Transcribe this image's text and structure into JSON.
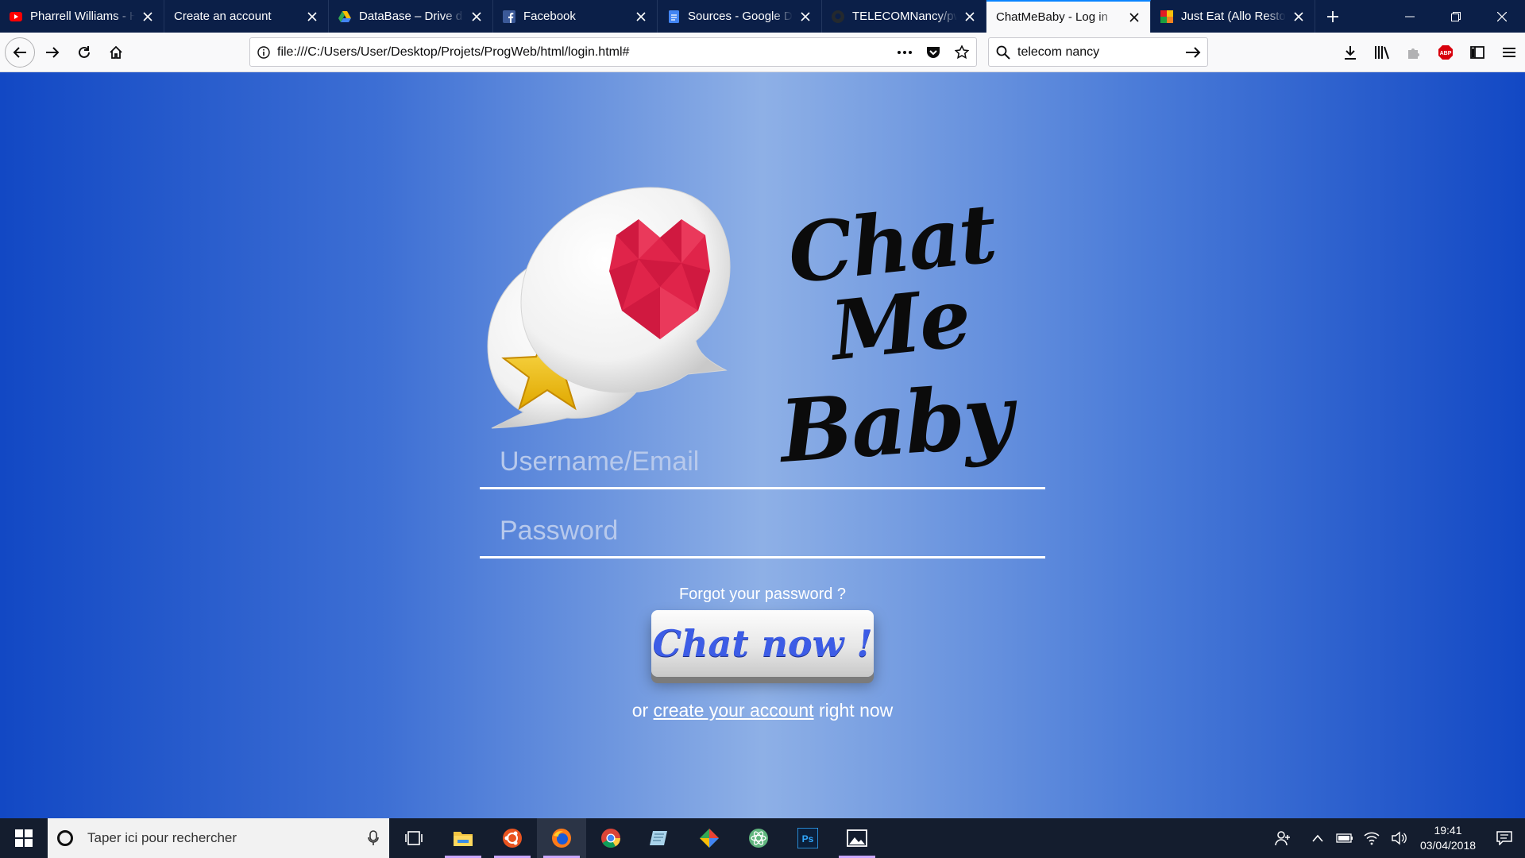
{
  "tabs": [
    {
      "title": "Pharrell Williams - H",
      "icon": "youtube-icon",
      "active": false
    },
    {
      "title": "Create an account",
      "icon": "none",
      "active": false
    },
    {
      "title": "DataBase – Drive d",
      "icon": "google-drive-icon",
      "active": false
    },
    {
      "title": "Facebook",
      "icon": "facebook-icon",
      "active": false
    },
    {
      "title": "Sources - Google D",
      "icon": "google-docs-icon",
      "active": false
    },
    {
      "title": "TELECOMNancy/pw",
      "icon": "github-icon",
      "active": false
    },
    {
      "title": "ChatMeBaby - Log in",
      "icon": "none",
      "active": true
    },
    {
      "title": "Just Eat (Allo Resto)",
      "icon": "just-eat-icon",
      "active": false
    }
  ],
  "navbar": {
    "url": "file:///C:/Users/User/Desktop/Projets/ProgWeb/html/login.html#",
    "search_value": "telecom nancy"
  },
  "page": {
    "brand_line1": "Chat Me",
    "brand_line2": "Baby",
    "username_placeholder": "Username/Email",
    "password_placeholder": "Password",
    "forgot_label": "Forgot your password ?",
    "chat_button_label": "Chat now !",
    "signup_prefix": "or",
    "signup_link": "create your account",
    "signup_suffix": "right now"
  },
  "taskbar": {
    "search_placeholder": "Taper ici pour rechercher",
    "time": "19:41",
    "date": "03/04/2018"
  },
  "colors": {
    "heart": "#e0244a",
    "star": "#f2c521",
    "button_text": "#3c5ce6"
  }
}
